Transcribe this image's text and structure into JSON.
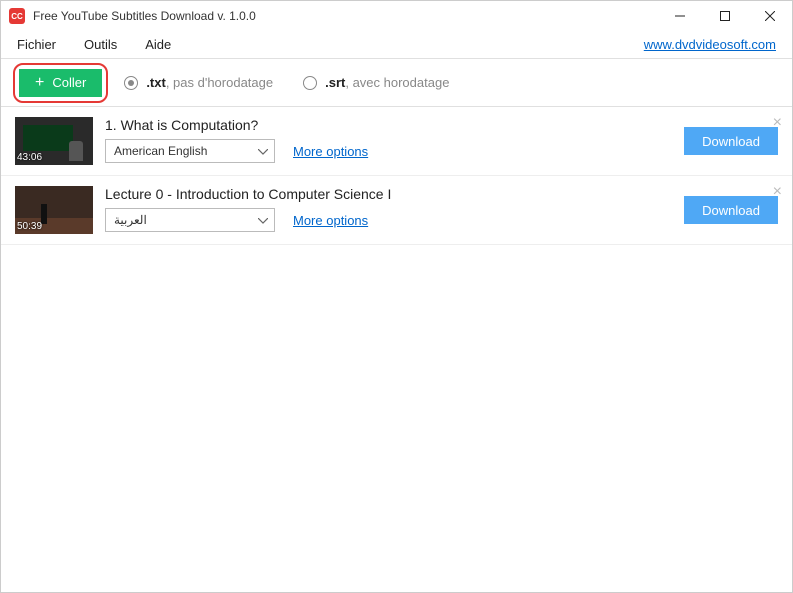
{
  "window": {
    "title": "Free YouTube Subtitles Download v. 1.0.0"
  },
  "menu": {
    "file": "Fichier",
    "tools": "Outils",
    "help": "Aide",
    "site_link": "www.dvdvideosoft.com"
  },
  "toolbar": {
    "paste_label": "Coller",
    "format_txt": ".txt",
    "format_txt_desc": ", pas d'horodatage",
    "format_srt": ".srt",
    "format_srt_desc": ", avec horodatage"
  },
  "items": [
    {
      "title": "1. What is Computation?",
      "duration": "43:06",
      "language": "American English",
      "more": "More options",
      "download": "Download"
    },
    {
      "title": "Lecture 0 - Introduction to Computer Science I",
      "duration": "50:39",
      "language": "العربية",
      "more": "More options",
      "download": "Download"
    }
  ]
}
